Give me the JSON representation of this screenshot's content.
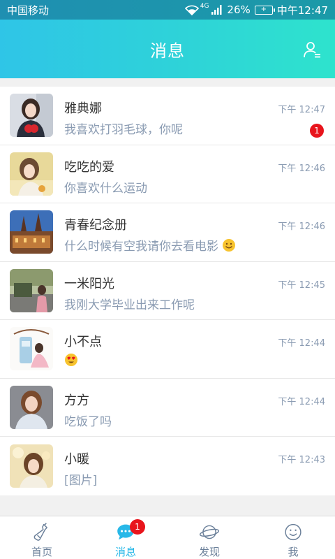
{
  "status_bar": {
    "carrier": "中国移动",
    "network": "4G",
    "battery": "26%",
    "time": "中午12:47"
  },
  "header": {
    "title": "消息",
    "contacts_icon": "contacts-icon"
  },
  "conversations": [
    {
      "name": "雅典娜",
      "message": "我喜欢打羽毛球，你呢",
      "time": "下午 12:47",
      "unread": "1"
    },
    {
      "name": "吃吃的爱",
      "message": "你喜欢什么运动",
      "time": "下午 12:46"
    },
    {
      "name": "青春纪念册",
      "message": "什么时候有空我请你去看电影",
      "time": "下午 12:46",
      "emoji": "smile-emoji"
    },
    {
      "name": "一米阳光",
      "message": "我刚大学毕业出来工作呢",
      "time": "下午 12:45"
    },
    {
      "name": "小不点",
      "message": "",
      "time": "下午 12:44",
      "emoji": "heart-eyes-emoji"
    },
    {
      "name": "方方",
      "message": "吃饭了吗",
      "time": "下午 12:44"
    },
    {
      "name": "小暖",
      "message": "[图片]",
      "time": "下午 12:43"
    }
  ],
  "tabs": [
    {
      "label": "首页",
      "icon": "bottle-icon"
    },
    {
      "label": "消息",
      "icon": "chat-icon",
      "badge": "1",
      "active": true
    },
    {
      "label": "发现",
      "icon": "planet-icon"
    },
    {
      "label": "我",
      "icon": "smiley-icon"
    }
  ],
  "colors": {
    "header_start": "#2fc5e7",
    "header_end": "#2ee3cd",
    "accent": "#28b8e8",
    "badge": "#e8141c",
    "secondary_text": "#8a9bb2"
  }
}
